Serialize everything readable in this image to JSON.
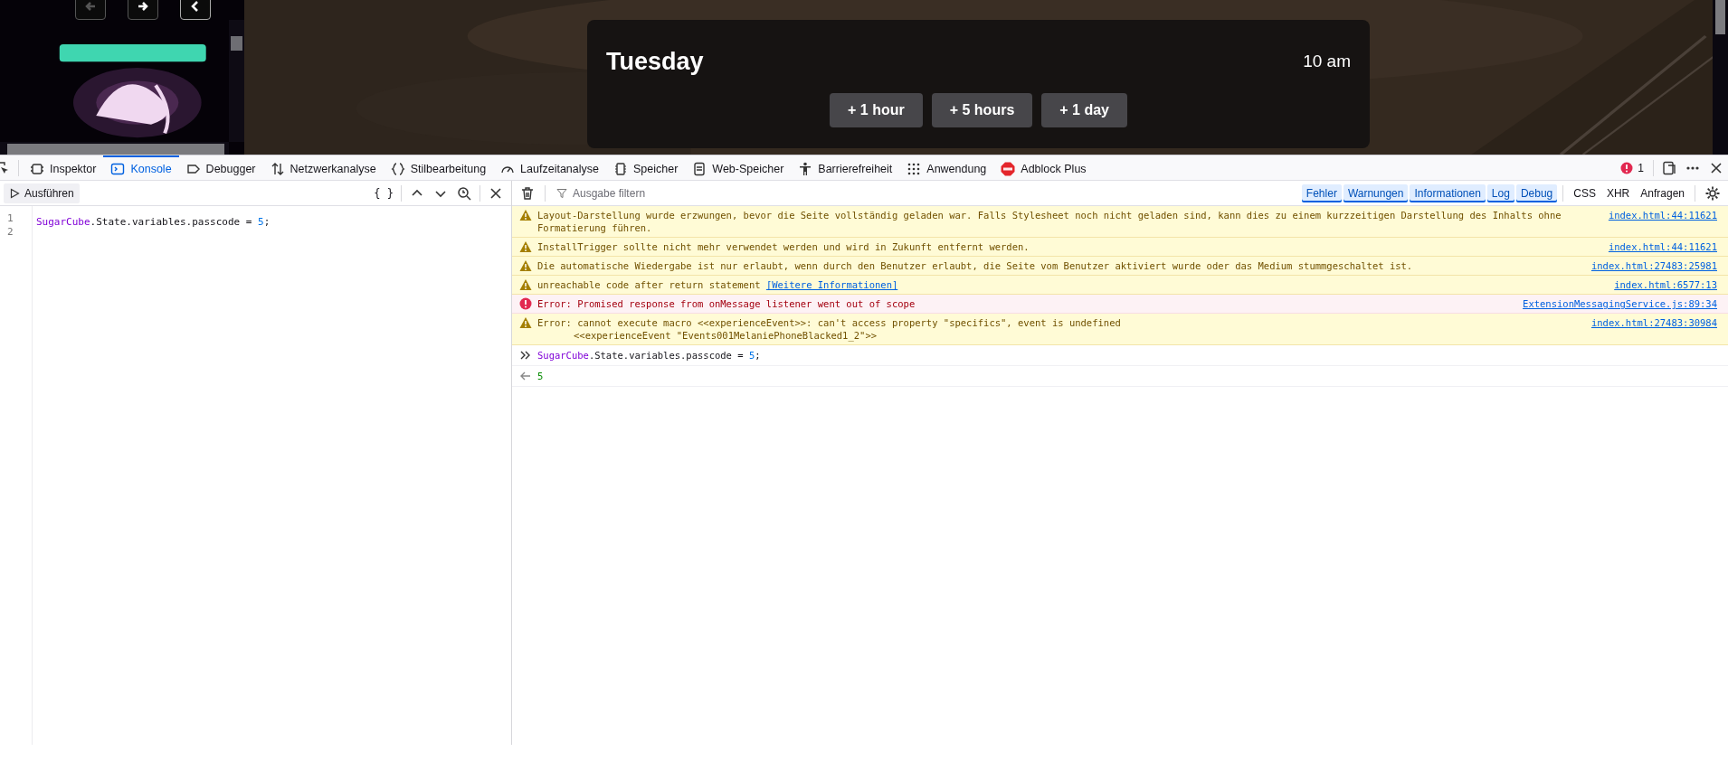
{
  "page": {
    "nav_buttons": [
      {
        "kind": "back"
      },
      {
        "kind": "forward"
      },
      {
        "kind": "collapse"
      }
    ],
    "time_card": {
      "day": "Tuesday",
      "time": "10 am",
      "buttons": [
        "+ 1 hour",
        "+ 5 hours",
        "+ 1 day"
      ]
    }
  },
  "devtools": {
    "tabs": [
      {
        "label": "Inspektor",
        "selected": false
      },
      {
        "label": "Konsole",
        "selected": true
      },
      {
        "label": "Debugger",
        "selected": false
      },
      {
        "label": "Netzwerkanalyse",
        "selected": false
      },
      {
        "label": "Stilbearbeitung",
        "selected": false
      },
      {
        "label": "Laufzeitanalyse",
        "selected": false
      },
      {
        "label": "Speicher",
        "selected": false
      },
      {
        "label": "Web-Speicher",
        "selected": false
      },
      {
        "label": "Barrierefreiheit",
        "selected": false
      },
      {
        "label": "Anwendung",
        "selected": false
      },
      {
        "label": "Adblock Plus",
        "selected": false
      }
    ],
    "error_count": "1",
    "editor": {
      "run_label": "Ausführen",
      "pretty_print": "{ }",
      "lines": [
        {
          "number": "1",
          "code": "SugarCube.State.variables.passcode = 5;"
        },
        {
          "number": "2"
        }
      ]
    },
    "filter": {
      "placeholder": "Ausgabe filtern",
      "levels": [
        {
          "label": "Fehler",
          "selected": true
        },
        {
          "label": "Warnungen",
          "selected": true
        },
        {
          "label": "Informationen",
          "selected": true
        },
        {
          "label": "Log",
          "selected": true
        },
        {
          "label": "Debug",
          "selected": true
        }
      ],
      "types": [
        {
          "label": "CSS",
          "selected": false
        },
        {
          "label": "XHR",
          "selected": false
        },
        {
          "label": "Anfragen",
          "selected": false
        }
      ]
    },
    "messages": [
      {
        "kind": "warning",
        "text": "Layout-Darstellung wurde erzwungen, bevor die Seite vollständig geladen war. Falls Stylesheet noch nicht geladen sind, kann dies zu einem kurzzeitigen Darstellung des Inhalts ohne Formatierung führen.",
        "source": "index.html:44:11621"
      },
      {
        "kind": "warning",
        "text": "InstallTrigger sollte nicht mehr verwendet werden und wird in Zukunft entfernt werden.",
        "source": "index.html:44:11621"
      },
      {
        "kind": "warning",
        "text": "Die automatische Wiedergabe ist nur erlaubt, wenn durch den Benutzer erlaubt, die Seite vom Benutzer aktiviert wurde oder das Medium stummgeschaltet ist.",
        "source": "index.html:27483:25981"
      },
      {
        "kind": "warning",
        "text": "unreachable code after return statement",
        "link": "[Weitere Informationen]",
        "source": "index.html:6577:13"
      },
      {
        "kind": "error",
        "text": "Error: Promised response from onMessage listener went out of scope",
        "source": "ExtensionMessagingService.js:89:34"
      },
      {
        "kind": "warning",
        "text": "Error: cannot execute macro <<experienceEvent>>: can't access property \"specifics\", event is undefined",
        "detail": "<<experienceEvent \"Events001MelaniePhoneBlacked1_2\">>",
        "source": "index.html:27483:30984"
      },
      {
        "kind": "input",
        "text": "SugarCube.State.variables.passcode = 5;"
      },
      {
        "kind": "result",
        "text": "5"
      }
    ]
  }
}
